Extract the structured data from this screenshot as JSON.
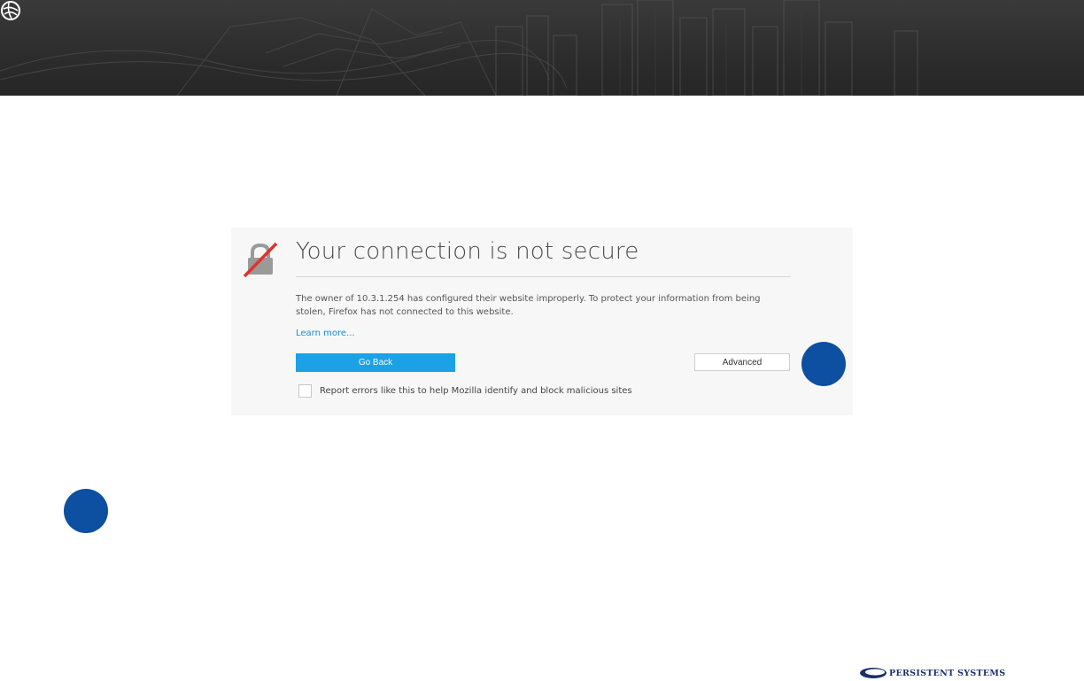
{
  "colors": {
    "banner": "#2c2c2c",
    "primary_button": "#1ba1e6",
    "link": "#1a8fd3",
    "callout": "#0d4fa0",
    "brand": "#1c2f6b",
    "warning_slash": "#e0322c"
  },
  "icons": {
    "banner_logo": "company-globe-logo",
    "error_icon": "broken-lock-icon"
  },
  "error_page": {
    "title": "Your connection is not secure",
    "description": "The owner of 10.3.1.254 has configured their website improperly. To protect your information from being stolen, Firefox has not connected to this website.",
    "learn_more": "Learn more...",
    "go_back_label": "Go Back",
    "advanced_label": "Advanced",
    "report_checkbox_checked": false,
    "report_label": "Report errors like this to help Mozilla identify and block malicious sites"
  },
  "footer": {
    "brand_name": "PERSISTENT SYSTEMS"
  }
}
